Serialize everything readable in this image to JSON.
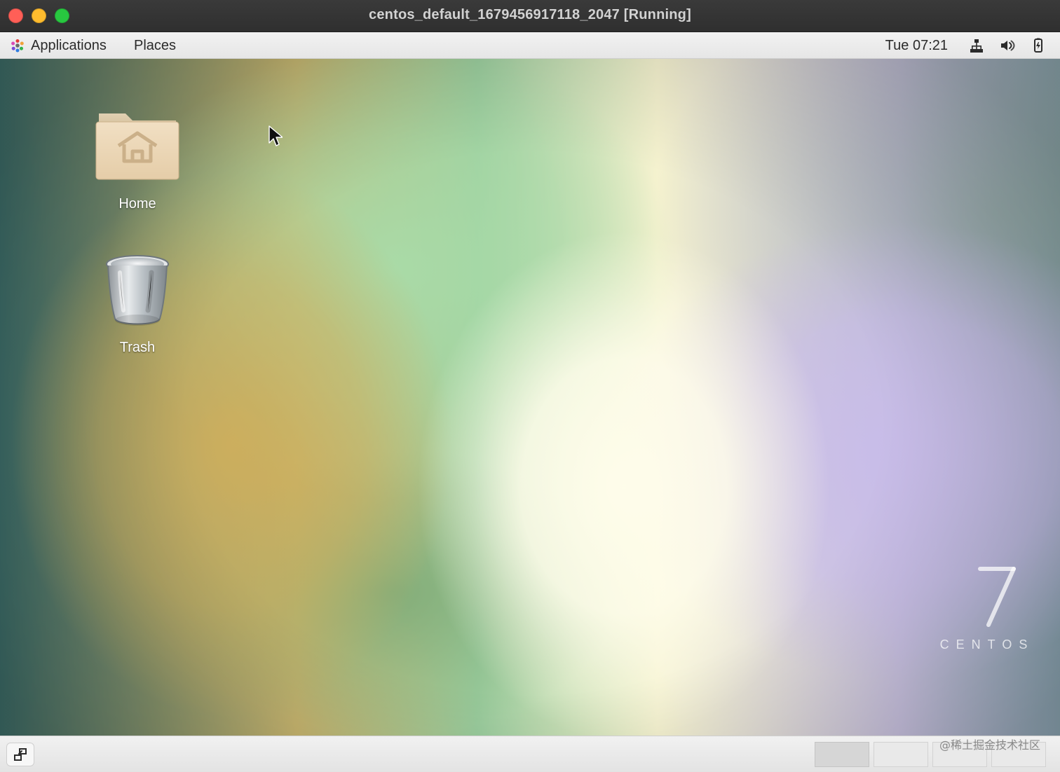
{
  "window": {
    "title": "centos_default_1679456917118_2047 [Running]"
  },
  "top_panel": {
    "applications_label": "Applications",
    "places_label": "Places",
    "clock": "Tue 07:21",
    "icons": [
      "network-icon",
      "volume-icon",
      "battery-icon"
    ]
  },
  "desktop": {
    "icons": [
      {
        "label": "Home",
        "icon": "home-folder-icon"
      },
      {
        "label": "Trash",
        "icon": "trash-icon"
      }
    ],
    "branding": {
      "number": "7",
      "wordmark": "CENTOS"
    }
  },
  "bottom_panel": {
    "workspace_count": 4,
    "active_workspace": 1
  },
  "overlay": {
    "watermark_text": "@稀土掘金技术社区"
  },
  "colors": {
    "traffic_close": "#ff5f57",
    "traffic_min": "#febc2e",
    "traffic_max": "#28c840",
    "panel_bg": "#eaeaea"
  }
}
